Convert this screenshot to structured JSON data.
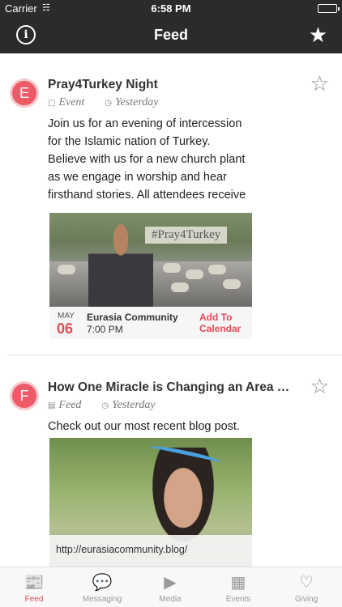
{
  "status_bar": {
    "carrier": "Carrier",
    "time": "6:58 PM"
  },
  "nav": {
    "title": "Feed",
    "info_icon": "info-icon",
    "star_icon": "star-icon"
  },
  "feed": {
    "items": [
      {
        "avatar_letter": "E",
        "title": "Pray4Turkey Night",
        "type": "Event",
        "when": "Yesterday",
        "body": "Join us for an evening of intercession for the Islamic nation of Turkey. Believe with us for a new church plant as we engage in worship and hear firsthand stories. All attendees receive",
        "image_tag": "#Pray4Turkey",
        "event_month": "MAY",
        "event_day": "06",
        "event_org": "Eurasia Community",
        "event_time": "7:00 PM",
        "add_to_calendar": "Add To Calendar"
      },
      {
        "avatar_letter": "F",
        "title": "How One Miracle is Changing an Area i...",
        "type": "Feed",
        "when": "Yesterday",
        "body": "Check out our most recent blog post.",
        "link_url": "http://eurasiacommunity.blog/"
      }
    ]
  },
  "tab_bar": {
    "tabs": [
      {
        "label": "Feed",
        "icon": "newspaper-icon"
      },
      {
        "label": "Messaging",
        "icon": "chat-icon"
      },
      {
        "label": "Media",
        "icon": "play-icon"
      },
      {
        "label": "Events",
        "icon": "calendar-icon"
      },
      {
        "label": "Giving",
        "icon": "heart-icon"
      }
    ],
    "active": "Feed"
  },
  "colors": {
    "accent": "#e34b57",
    "nav_bg": "#2b2b2b",
    "avatar": "#ee5a67"
  }
}
